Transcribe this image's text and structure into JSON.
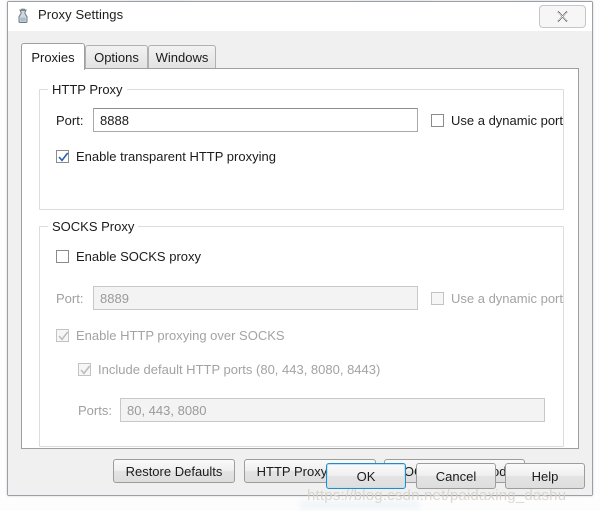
{
  "window": {
    "title": "Proxy Settings",
    "icon": "fiddler-jar-icon",
    "close_label": "X"
  },
  "tabs": [
    {
      "label": "Proxies",
      "active": true
    },
    {
      "label": "Options",
      "active": false
    },
    {
      "label": "Windows",
      "active": false
    }
  ],
  "http_proxy": {
    "group_title": "HTTP Proxy",
    "port_label": "Port:",
    "port_value": "8888",
    "port_placeholder": "",
    "dynamic_port": {
      "label": "Use a dynamic port",
      "checked": false,
      "enabled": true
    },
    "transparent": {
      "label": "Enable transparent HTTP proxying",
      "checked": true,
      "enabled": true
    }
  },
  "socks_proxy": {
    "group_title": "SOCKS Proxy",
    "enable": {
      "label": "Enable SOCKS proxy",
      "checked": false,
      "enabled": true
    },
    "port_label": "Port:",
    "port_value": "8889",
    "port_placeholder": "",
    "dynamic_port": {
      "label": "Use a dynamic port",
      "checked": false,
      "enabled": false
    },
    "http_over_socks": {
      "label": "Enable HTTP proxying over SOCKS",
      "checked": true,
      "enabled": false
    },
    "default_ports": {
      "label": "Include default HTTP ports (80, 443, 8080, 8443)",
      "checked": true,
      "enabled": false
    },
    "ports_label": "Ports:",
    "ports_value": "80, 443, 8080"
  },
  "mode_buttons": [
    {
      "label": "Restore Defaults"
    },
    {
      "label": "HTTP Proxy Mode"
    },
    {
      "label": "SOCKS Proxy Mode"
    }
  ],
  "dialog_buttons": [
    {
      "label": "OK",
      "focused": true
    },
    {
      "label": "Cancel",
      "focused": false
    },
    {
      "label": "Help",
      "focused": false
    }
  ],
  "watermark": {
    "text": "https://blog.csdn.net/paidaxing_dashu"
  },
  "colors": {
    "accent": "#2a8ac0",
    "window_bg": "#f0f0f0",
    "page_bg": "#ffffff",
    "text": "#1b1b1b",
    "disabled_text": "#a3a3a3"
  }
}
